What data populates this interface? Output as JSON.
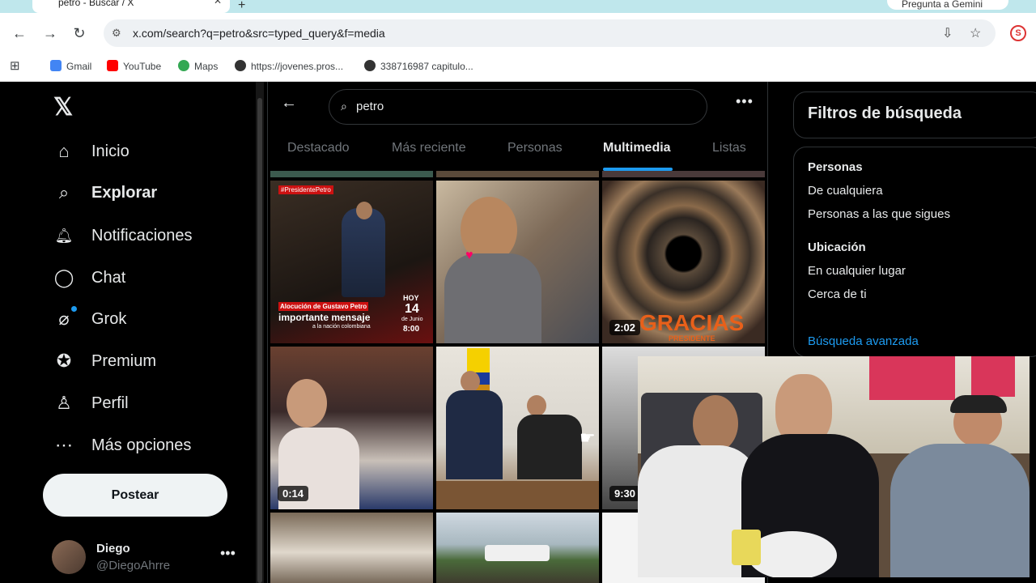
{
  "browser": {
    "tab_title": "petro - Buscar / X",
    "new_tab_symbol": "+",
    "gemini_label": "Pregunta a Gemini",
    "url": "x.com/search?q=petro&src=typed_query&f=media",
    "bookmarks": [
      {
        "label": "Gmail",
        "color": "#4285f4"
      },
      {
        "label": "YouTube",
        "color": "#ff0000"
      },
      {
        "label": "Maps",
        "color": "#34a853"
      },
      {
        "label": "https://jovenes.pros...",
        "color": "#333333"
      },
      {
        "label": "338716987 capitulo...",
        "color": "#333333"
      }
    ]
  },
  "sidebar": {
    "items": [
      {
        "label": "Inicio",
        "icon": "home-icon",
        "glyph": "⌂"
      },
      {
        "label": "Explorar",
        "icon": "search-icon",
        "glyph": "⌕"
      },
      {
        "label": "Notificaciones",
        "icon": "bell-icon",
        "glyph": "🔔︎"
      },
      {
        "label": "Chat",
        "icon": "chat-icon",
        "glyph": "◯"
      },
      {
        "label": "Grok",
        "icon": "grok-icon",
        "glyph": "⌀"
      },
      {
        "label": "Premium",
        "icon": "premium-icon",
        "glyph": "✪"
      },
      {
        "label": "Perfil",
        "icon": "person-icon",
        "glyph": "♙"
      },
      {
        "label": "Más opciones",
        "icon": "more-icon",
        "glyph": "⋯"
      }
    ],
    "post_label": "Postear",
    "profile": {
      "name": "Diego",
      "handle": "@DiegoAhrre"
    }
  },
  "search": {
    "query": "petro",
    "tabs": [
      "Destacado",
      "Más reciente",
      "Personas",
      "Multimedia",
      "Listas"
    ],
    "active_tab": "Multimedia"
  },
  "media": {
    "durations": [
      "2:02",
      "0:14",
      "9:30"
    ],
    "thumb_texts": {
      "hashtag": "#PresidentePetro",
      "alocucion": "Alocución de Gustavo Petro",
      "mensaje": "importante mensaje",
      "nacion": "a la nación colombiana",
      "hoy": "HOY",
      "dia": "14",
      "mes": "de Junio",
      "hora": "8:00",
      "gracias": "GRACIAS",
      "presidente": "PRESIDENTE"
    }
  },
  "filters": {
    "title": "Filtros de búsqueda",
    "people_heading": "Personas",
    "people_options": [
      "De cualquiera",
      "Personas a las que sigues"
    ],
    "location_heading": "Ubicación",
    "location_options": [
      "En cualquier lugar",
      "Cerca de ti"
    ],
    "advanced_link": "Búsqueda avanzada"
  },
  "colors": {
    "accent": "#1d9bf0",
    "background": "#000000",
    "text": "#e7e9ea",
    "muted": "#71767b"
  }
}
